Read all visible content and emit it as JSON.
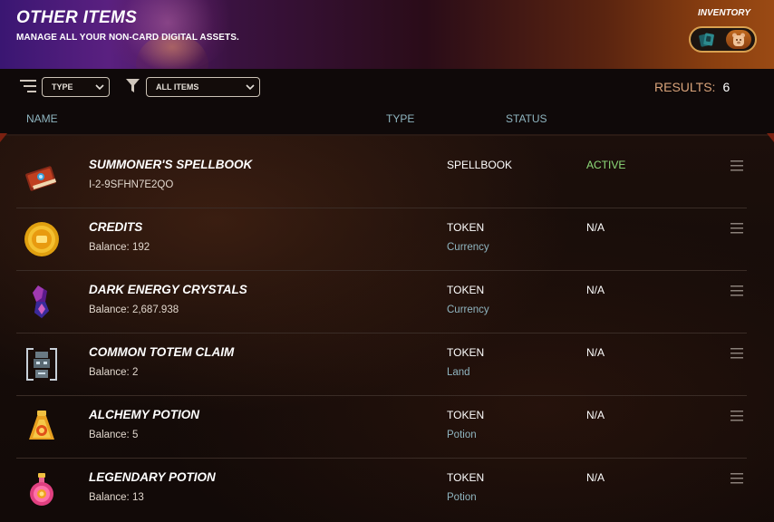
{
  "header": {
    "title": "OTHER ITEMS",
    "subtitle": "MANAGE ALL YOUR NON-CARD DIGITAL ASSETS.",
    "inventory_label": "INVENTORY",
    "inventory_toggle": [
      "cards-icon",
      "items-bear-icon"
    ]
  },
  "toolbar": {
    "sort_icon": "sort-lines-icon",
    "type_select": "TYPE",
    "filter_icon": "funnel-icon",
    "items_select": "ALL ITEMS",
    "results_label": "RESULTS:",
    "results_count": "6"
  },
  "columns": {
    "name": "NAME",
    "type": "TYPE",
    "status": "STATUS"
  },
  "items": [
    {
      "name": "SUMMONER'S SPELLBOOK",
      "sub": "I-2-9SFHN7E2QO",
      "type": "SPELLBOOK",
      "type_sub": "",
      "status": "ACTIVE",
      "icon": "spellbook-icon"
    },
    {
      "name": "CREDITS",
      "sub": "Balance: 192",
      "type": "TOKEN",
      "type_sub": "Currency",
      "status": "N/A",
      "icon": "credits-coin-icon"
    },
    {
      "name": "DARK ENERGY CRYSTALS",
      "sub": "Balance: 2,687.938",
      "type": "TOKEN",
      "type_sub": "Currency",
      "status": "N/A",
      "icon": "crystal-icon"
    },
    {
      "name": "COMMON TOTEM CLAIM",
      "sub": "Balance: 2",
      "type": "TOKEN",
      "type_sub": "Land",
      "status": "N/A",
      "icon": "totem-icon"
    },
    {
      "name": "ALCHEMY POTION",
      "sub": "Balance: 5",
      "type": "TOKEN",
      "type_sub": "Potion",
      "status": "N/A",
      "icon": "alchemy-potion-icon"
    },
    {
      "name": "LEGENDARY POTION",
      "sub": "Balance: 13",
      "type": "TOKEN",
      "type_sub": "Potion",
      "status": "N/A",
      "icon": "legendary-potion-icon"
    }
  ],
  "colors": {
    "accent_orange": "#d9a37a",
    "status_active": "#8edc7a",
    "column_header": "#8fb5c0"
  }
}
